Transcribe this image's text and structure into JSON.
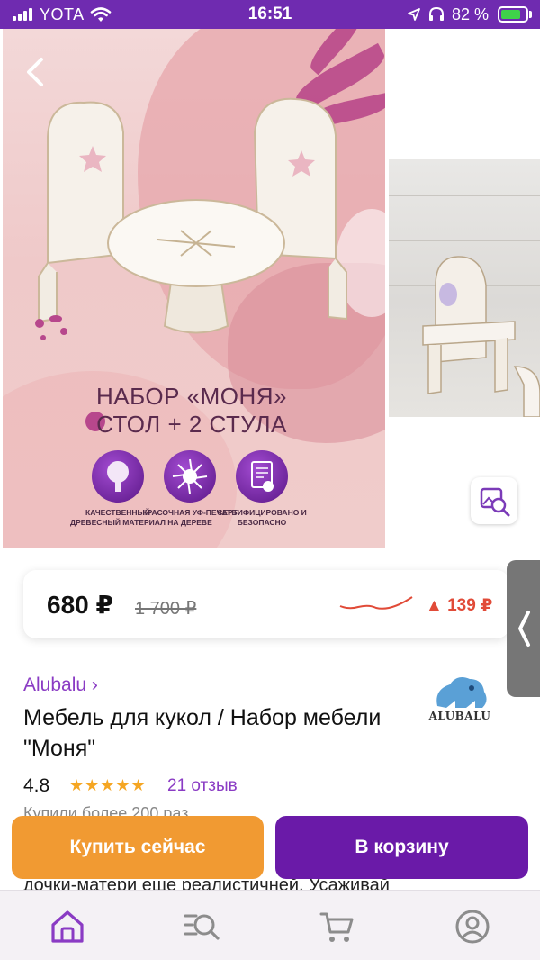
{
  "status_bar": {
    "carrier": "YOTA",
    "time": "16:51",
    "battery": "82 %",
    "battery_level": 0.82
  },
  "gallery": {
    "title_line1": "НАБОР «МОНЯ»",
    "title_line2": "СТОЛ + 2 СТУЛА",
    "features": [
      {
        "icon": "tree-icon",
        "text": "КАЧЕСТВЕННЫЙ ДРЕВЕСНЫЙ МАТЕРИАЛ"
      },
      {
        "icon": "splash-icon",
        "text": "КРАСОЧНАЯ УФ-ПЕЧАТЬ НА ДЕРЕВЕ"
      },
      {
        "icon": "certificate-icon",
        "text": "СЕРТИФИЦИРОВАНО И БЕЗОПАСНО"
      }
    ]
  },
  "price": {
    "current": "680 ₽",
    "old": "1 700 ₽",
    "delta": "▲ 139 ₽",
    "colors": {
      "delta": "#e14b38"
    }
  },
  "product": {
    "brand": "Alubalu ›",
    "brand_logo_text": "Alubalu",
    "name": "Мебель для кукол /  Набор мебели \"Моня\"",
    "rating": "4.8",
    "stars": "★★★★★",
    "reviews": "21 отзыв",
    "bought": "Купили более 200 раз",
    "description_partial": "дочки-матери еще реалистичней. Усаживай"
  },
  "actions": {
    "buy_now": "Купить сейчас",
    "add_to_cart": "В корзину"
  },
  "nav": {
    "items": [
      {
        "icon": "home-icon",
        "active": true
      },
      {
        "icon": "catalog-search-icon",
        "active": false
      },
      {
        "icon": "cart-icon",
        "active": false
      },
      {
        "icon": "profile-icon",
        "active": false
      }
    ]
  },
  "colors": {
    "accent": "#6a1aa8",
    "status_bar": "#6f2bb0",
    "buy_now": "#f19a32",
    "link": "#8a3bc4",
    "stars": "#f5a623"
  }
}
